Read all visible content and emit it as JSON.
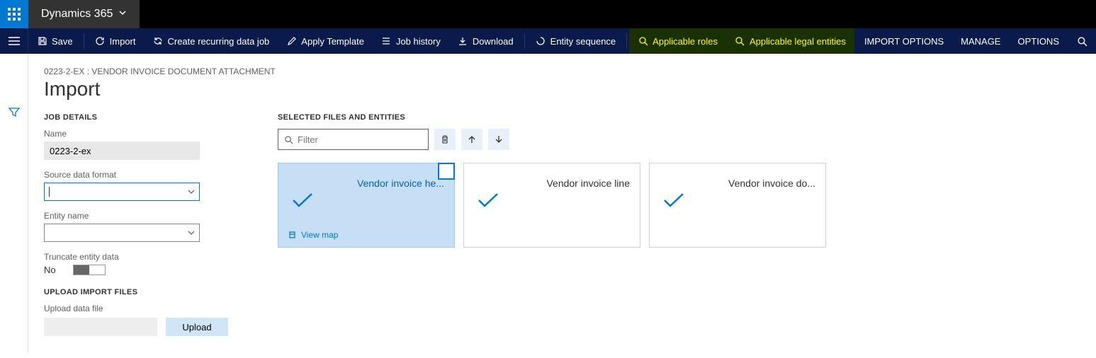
{
  "header": {
    "brand": "Dynamics 365"
  },
  "commands": {
    "save": "Save",
    "import": "Import",
    "recurring": "Create recurring data job",
    "apply_template": "Apply Template",
    "job_history": "Job history",
    "download": "Download",
    "entity_sequence": "Entity sequence",
    "applicable_roles": "Applicable roles",
    "applicable_legal_entities": "Applicable legal entities",
    "import_options": "IMPORT OPTIONS",
    "manage": "MANAGE",
    "options": "OPTIONS"
  },
  "page": {
    "breadcrumb": "0223-2-EX : VENDOR INVOICE DOCUMENT ATTACHMENT",
    "title": "Import"
  },
  "job_details": {
    "section": "JOB DETAILS",
    "name_label": "Name",
    "name_value": "0223-2-ex",
    "source_label": "Source data format",
    "source_value": "",
    "entity_label": "Entity name",
    "entity_value": "",
    "truncate_label": "Truncate entity data",
    "truncate_value": "No"
  },
  "upload": {
    "section": "UPLOAD IMPORT FILES",
    "label": "Upload data file",
    "button": "Upload"
  },
  "entities": {
    "section": "SELECTED FILES AND ENTITIES",
    "filter_placeholder": "Filter",
    "cards": [
      {
        "title": "Vendor invoice he...",
        "selected": true,
        "view_map": "View map"
      },
      {
        "title": "Vendor invoice line",
        "selected": false
      },
      {
        "title": "Vendor invoice do...",
        "selected": false
      }
    ]
  }
}
